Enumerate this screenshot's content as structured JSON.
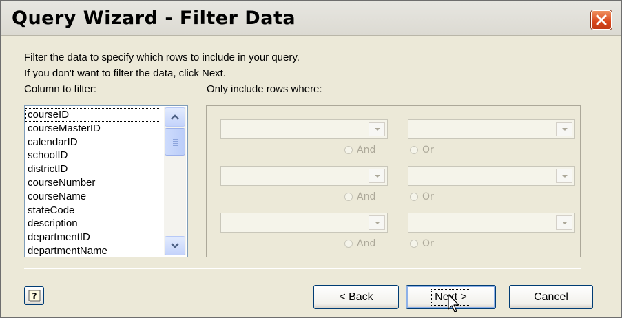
{
  "window": {
    "title": "Query Wizard - Filter Data"
  },
  "intro": {
    "line1": "Filter the data to specify which rows to include in your query.",
    "line2": "If you don't want to filter the data, click Next."
  },
  "column_label": "Column to filter:",
  "filter_label": "Only include rows where:",
  "columns": [
    "courseID",
    "courseMasterID",
    "calendarID",
    "schoolID",
    "districtID",
    "courseNumber",
    "courseName",
    "stateCode",
    "description",
    "departmentID",
    "departmentName"
  ],
  "selected_column": "courseID",
  "conditions": [
    {
      "operator": "",
      "value": "",
      "and_label": "And",
      "or_label": "Or"
    },
    {
      "operator": "",
      "value": "",
      "and_label": "And",
      "or_label": "Or"
    },
    {
      "operator": "",
      "value": "",
      "and_label": "And",
      "or_label": "Or"
    }
  ],
  "buttons": {
    "help": "?",
    "back": "< Back",
    "next": "Next >",
    "cancel": "Cancel"
  },
  "colors": {
    "dialog_bg": "#ece9d8",
    "close_button": "#d8461c",
    "default_button_focus": "#8eb1e8"
  }
}
